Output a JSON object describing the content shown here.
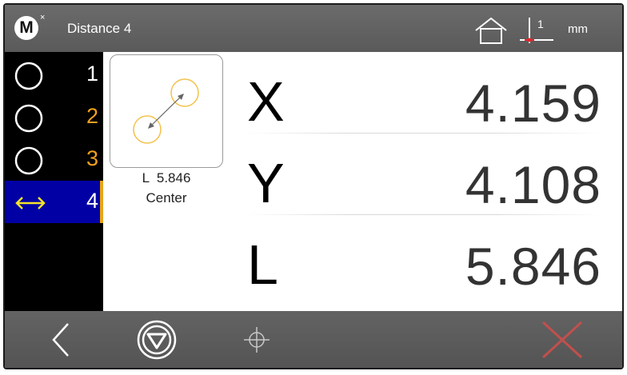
{
  "header": {
    "logo_letter": "M",
    "logo_superscript": "×",
    "title": "Distance 4",
    "datum_label": "1",
    "unit": "mm"
  },
  "sidebar": {
    "items": [
      {
        "number": "1",
        "icon": "circle-icon",
        "number_color": "#ffffff",
        "selected": false
      },
      {
        "number": "2",
        "icon": "circle-icon",
        "number_color": "#f2a01e",
        "selected": false
      },
      {
        "number": "3",
        "icon": "circle-icon",
        "number_color": "#f2a01e",
        "selected": false
      },
      {
        "number": "4",
        "icon": "distance-arrow-icon",
        "number_color": "#ffffff",
        "selected": true
      }
    ]
  },
  "feature_panel": {
    "icon": "distance-between-circles-icon",
    "value_label": "L  5.846",
    "reference": "Center"
  },
  "readout": {
    "rows": [
      {
        "axis": "X",
        "value": "4.159"
      },
      {
        "axis": "Y",
        "value": "4.108"
      },
      {
        "axis": "L",
        "value": "5.846"
      }
    ]
  },
  "toolbar": {
    "buttons": [
      "back-icon",
      "probe-action-icon",
      "crosshair-icon",
      "cancel-icon"
    ]
  },
  "colors": {
    "selected_row_bg": "#0000a5",
    "accent_orange": "#f2a01e",
    "cancel_red": "#c0504d",
    "bar_gray": "#5e5e5e"
  }
}
